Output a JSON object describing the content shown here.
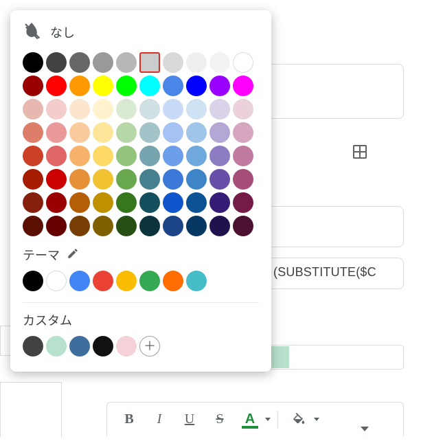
{
  "popover": {
    "none_label": "なし",
    "theme_label": "テーマ",
    "custom_label": "カスタム",
    "selected_index": 5,
    "standard_colors": [
      "#000000",
      "#434343",
      "#666666",
      "#999999",
      "#b7b7b7",
      "#cccccc",
      "#d9d9d9",
      "#efefef",
      "#f3f3f3",
      "#ffffff",
      "#980000",
      "#ff0000",
      "#ff9900",
      "#ffff00",
      "#00ff00",
      "#00ffff",
      "#4a86e8",
      "#0000ff",
      "#9900ff",
      "#ff00ff",
      "#e6b8af",
      "#f4cccc",
      "#fce5cd",
      "#fff2cc",
      "#d9ead3",
      "#d0e0e3",
      "#c9daf8",
      "#cfe2f3",
      "#d9d2e9",
      "#ead1dc",
      "#dd7e6b",
      "#ea9999",
      "#f9cb9c",
      "#ffe599",
      "#b6d7a8",
      "#a2c4c9",
      "#a4c2f4",
      "#9fc5e8",
      "#b4a7d6",
      "#d5a6bd",
      "#cc4125",
      "#e06666",
      "#f6b26b",
      "#ffd966",
      "#93c47d",
      "#76a5af",
      "#6d9eeb",
      "#6fa8dc",
      "#8e7cc3",
      "#c27ba0",
      "#a61c00",
      "#cc0000",
      "#e69138",
      "#f1c232",
      "#6aa84f",
      "#45818e",
      "#3c78d8",
      "#3d85c6",
      "#674ea7",
      "#a64d79",
      "#85200c",
      "#990000",
      "#b45f06",
      "#bf9000",
      "#38761d",
      "#134f5c",
      "#1155cc",
      "#0b5394",
      "#351c75",
      "#741b47",
      "#5b0f00",
      "#660000",
      "#783f04",
      "#7f6000",
      "#274e13",
      "#0c343d",
      "#1c4587",
      "#073763",
      "#20124d",
      "#4c1130"
    ],
    "theme_colors": [
      "#000000",
      "#ffffff",
      "#4285f4",
      "#ea4335",
      "#fbbc04",
      "#34a853",
      "#ff6d01",
      "#46bdc6"
    ],
    "custom_colors": [
      "#424242",
      "#b7e1cd",
      "#3d6e9c",
      "#111111",
      "#f4d2d7"
    ]
  },
  "formula_visible_text": "(SUBSTITUTE($C",
  "toolbar": {
    "bold": "B",
    "italic": "I",
    "underline": "U",
    "strike": "S",
    "textcolor": "A"
  }
}
